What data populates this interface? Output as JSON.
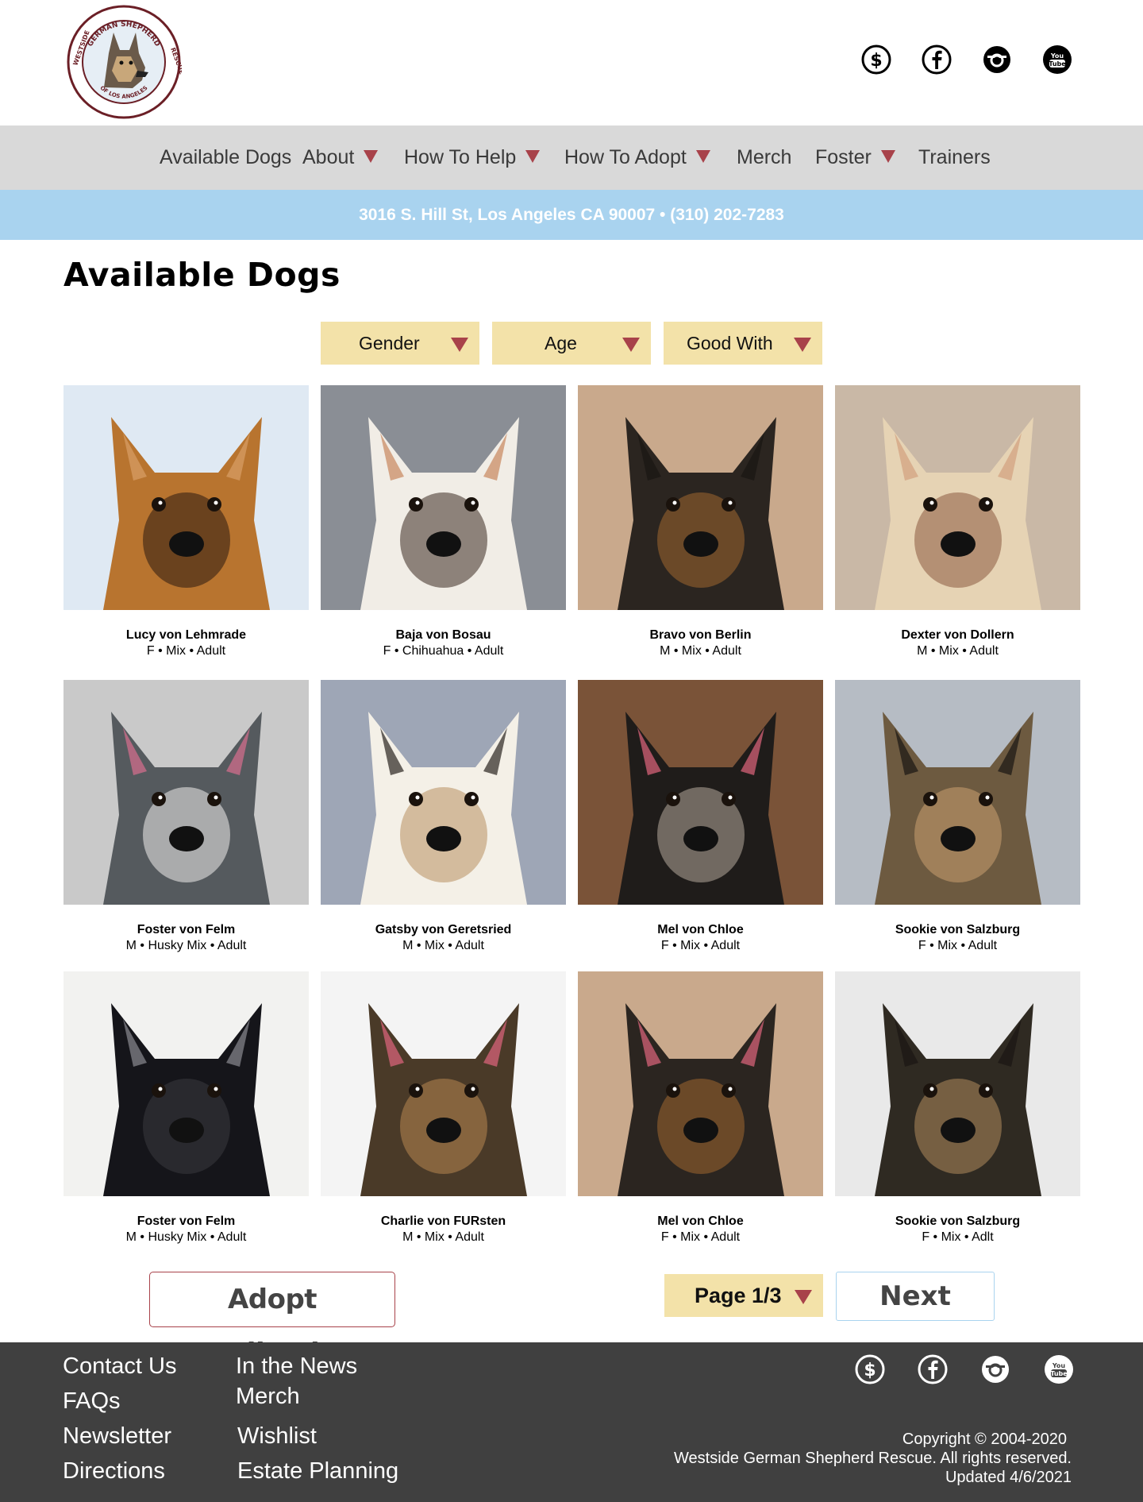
{
  "header": {
    "logo_text_top": "GERMAN SHEPHERD",
    "logo_text_left": "WESTSIDE",
    "logo_text_right": "RESCUE",
    "logo_text_bottom": "OF LOS ANGELES",
    "social_icons": [
      "donate-dollar-icon",
      "facebook-icon",
      "instagram-icon",
      "youtube-icon"
    ]
  },
  "nav": {
    "items": [
      {
        "label": "Available Dogs",
        "dropdown": false
      },
      {
        "label": "About",
        "dropdown": true
      },
      {
        "label": "How To Help",
        "dropdown": true
      },
      {
        "label": "How To Adopt",
        "dropdown": true
      },
      {
        "label": "Merch",
        "dropdown": false
      },
      {
        "label": "Foster",
        "dropdown": true
      },
      {
        "label": "Trainers",
        "dropdown": false
      }
    ]
  },
  "address_bar": {
    "text": "3016 S. Hill St, Los Angeles CA 90007 •  (310) 202-7283"
  },
  "page_title": "Available Dogs",
  "filters": [
    {
      "label": "Gender"
    },
    {
      "label": "Age"
    },
    {
      "label": "Good With"
    }
  ],
  "dogs": [
    {
      "name": "Lucy von Lehmrade",
      "info": "F • Mix • Adult"
    },
    {
      "name": "Baja von Bosau",
      "info": "F • Chihuahua • Adult"
    },
    {
      "name": "Bravo von Berlin",
      "info": "M • Mix • Adult"
    },
    {
      "name": "Dexter von Dollern",
      "info": "M • Mix • Adult"
    },
    {
      "name": "Foster von Felm",
      "info": "M • Husky Mix • Adult"
    },
    {
      "name": "Gatsby von Geretsried",
      "info": "M • Mix • Adult"
    },
    {
      "name": "Mel von Chloe",
      "info": "F • Mix • Adult"
    },
    {
      "name": "Sookie von Salzburg",
      "info": "F • Mix • Adult"
    },
    {
      "name": "Foster von Felm",
      "info": "M • Husky Mix • Adult"
    },
    {
      "name": "Charlie von FURsten",
      "info": "M • Mix • Adult"
    },
    {
      "name": "Mel von Chloe",
      "info": "F • Mix • Adult"
    },
    {
      "name": "Sookie von Salzburg",
      "info": "F • Mix • Adlt"
    }
  ],
  "actions": {
    "adopt_label": "Adopt Application",
    "page_label": "Page 1/3",
    "next_label": "Next"
  },
  "footer": {
    "links_col1": [
      "Contact Us",
      "FAQs",
      "Newsletter",
      "Directions"
    ],
    "links_col2": [
      "In the News",
      "Merch",
      "Wishlist",
      "Estate Planning"
    ],
    "copyright_line1": "Copyright © 2004-2020",
    "copyright_line2": "Westside German Shepherd Rescue. All rights reserved.",
    "copyright_line3": "Updated 4/6/2021"
  },
  "colors": {
    "accent_red": "#a8424a",
    "nav_bg": "#d9d9d9",
    "address_bg": "#a9d3ef",
    "filter_bg": "#f3e2a9",
    "footer_bg": "#404040"
  }
}
